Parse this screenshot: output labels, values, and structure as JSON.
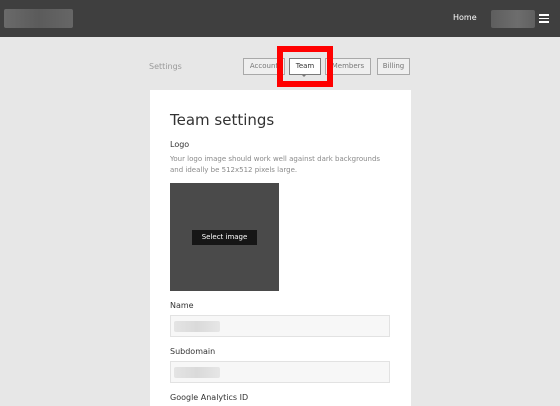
{
  "header": {
    "home_label": "Home",
    "menu_icon": "hamburger-menu-icon"
  },
  "settings_nav": {
    "section_label": "Settings",
    "tabs": [
      {
        "label": "Account"
      },
      {
        "label": "Team",
        "active": true
      },
      {
        "label": "Members"
      },
      {
        "label": "Billing"
      }
    ],
    "highlight_color": "#ff0000"
  },
  "team_settings": {
    "title": "Team settings",
    "logo": {
      "label": "Logo",
      "help_text": "Your logo image should work well against dark backgrounds and ideally be 512x512 pixels large.",
      "select_button_label": "Select image"
    },
    "fields": {
      "name_label": "Name",
      "subdomain_label": "Subdomain",
      "google_analytics_label": "Google Analytics ID"
    }
  }
}
